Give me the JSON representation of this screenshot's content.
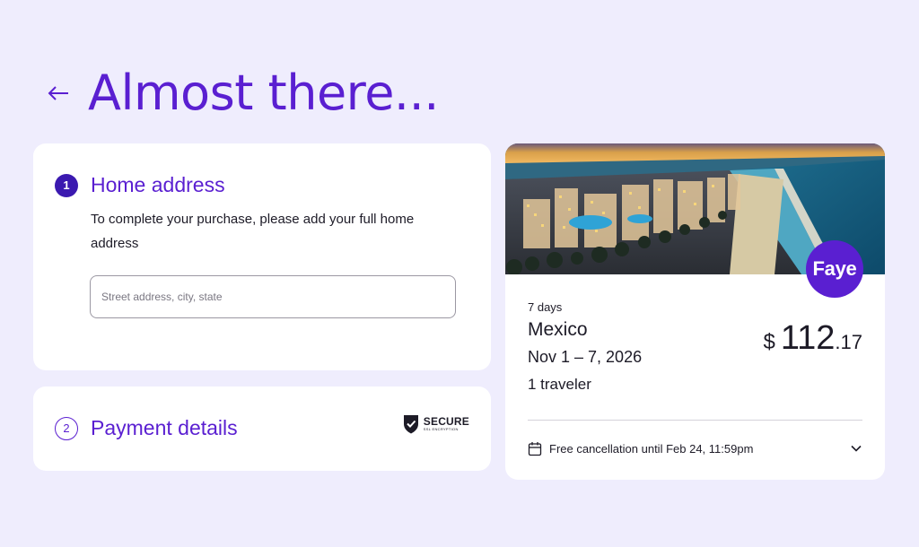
{
  "header": {
    "back_icon": "arrow-left-icon",
    "title": "Almost there..."
  },
  "address_section": {
    "step_number": "1",
    "title": "Home address",
    "description": "To complete your purchase, please add your full home address",
    "input": {
      "value": "",
      "placeholder": "Street address, city, state"
    }
  },
  "payment_section": {
    "step_number": "2",
    "title": "Payment details",
    "secure_badge": {
      "icon": "shield-check-icon",
      "label": "SECURE",
      "sublabel": "SSL ENCRYPTION"
    }
  },
  "trip": {
    "brand": "Faye",
    "duration": "7 days",
    "destination": "Mexico",
    "dates": "Nov 1 – 7, 2026",
    "travelers": "1 traveler",
    "price": {
      "currency": "$",
      "whole": "112",
      "cents": ".17"
    },
    "cancellation": {
      "icon": "calendar-icon",
      "text": "Free cancellation until Feb 24, 11:59pm",
      "expand_icon": "chevron-down-icon"
    }
  },
  "colors": {
    "background": "#efedfd",
    "accent": "#5a1fd1",
    "step_fill": "#3b19b0",
    "card": "#ffffff"
  }
}
